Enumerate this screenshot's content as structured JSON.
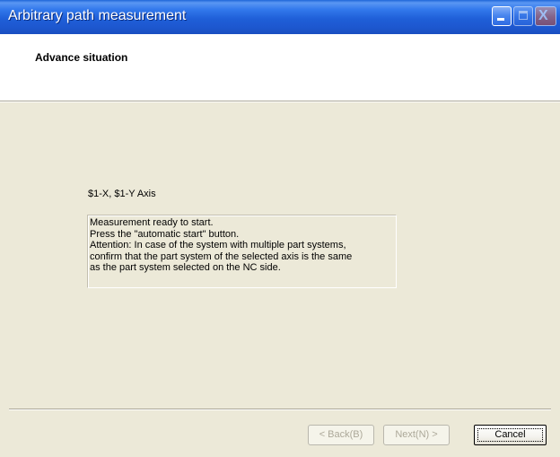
{
  "window": {
    "title": "Arbitrary path measurement",
    "controls": {
      "minimize_icon": "minimize-icon",
      "maximize_icon": "maximize-icon",
      "close_icon": "close-icon",
      "close_glyph": "X"
    }
  },
  "header": {
    "title": "Advance situation"
  },
  "main": {
    "axis_label": "$1-X, $1-Y Axis",
    "message_lines": [
      "Measurement ready to start.",
      "Press the \"automatic start\" button.",
      "Attention: In case of the system with multiple part systems,",
      "confirm that the part system of the selected axis is the same",
      "as the part system selected on the NC side."
    ]
  },
  "footer": {
    "back_label": "< Back(B)",
    "next_label": "Next(N) >",
    "cancel_label": "Cancel"
  },
  "colors": {
    "titlebar": "#1f5fd8",
    "dialog_bg": "#ece9d8",
    "header_bg": "#ffffff"
  }
}
